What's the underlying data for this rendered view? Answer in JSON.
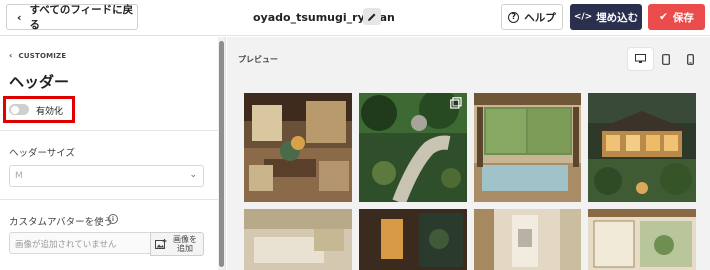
{
  "header": {
    "back_label": "すべてのフィードに戻る",
    "feed_name": "oyado_tsumugi_ryokan",
    "help_label": "ヘルプ",
    "embed_label": "埋め込む",
    "save_label": "保存"
  },
  "sidebar": {
    "breadcrumb": "CUSTOMIZE",
    "title": "ヘッダー",
    "toggle_label": "有効化",
    "toggle_on": false,
    "header_size_label": "ヘッダーサイズ",
    "header_size_value": "M",
    "custom_avatar_label": "カスタムアバターを使う",
    "avatar_placeholder": "画像が追加されていません",
    "add_image_label": "画像を\n追加"
  },
  "preview": {
    "label": "プレビュー",
    "devices": [
      "desktop-icon",
      "tablet-icon",
      "mobile-icon"
    ],
    "active_device": "desktop-icon"
  },
  "colors": {
    "embed": "#2b2f4e",
    "save": "#ea4c4c",
    "highlight": "#e00000"
  }
}
